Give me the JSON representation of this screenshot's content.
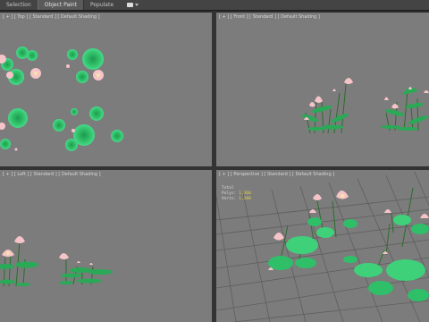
{
  "toolbar": {
    "tabs": [
      {
        "label": "Selection",
        "active": false
      },
      {
        "label": "Object Paint",
        "active": true
      },
      {
        "label": "Populate",
        "active": false
      }
    ],
    "dropdown_icon": "square-dropdown-icon"
  },
  "viewports": {
    "top": {
      "label": "[ + ] [ Top ] [ Standard ] [ Default Shading ]"
    },
    "front": {
      "label": "[ + ] [ Front ] [ Standard ] [ Default Shading ]"
    },
    "left": {
      "label": "[ + ] [ Left ] [ Standard ] [ Default Shading ]"
    },
    "perspective": {
      "label": "[ + ] [ Perspective ] [ Standard ] [ Default Shading ]",
      "stats": [
        {
          "key": "Total",
          "value": ""
        },
        {
          "key": "Polys:",
          "value": "1,360"
        },
        {
          "key": "Verts:",
          "value": "1,380"
        }
      ]
    }
  },
  "colors": {
    "viewport_bg": "#7c7c7c",
    "leaf_light": "#3fd17a",
    "leaf_dark": "#1f9a4e",
    "petal": "#f6c4c8",
    "petal_center": "#f4e7a4",
    "stem": "#2a6e2e",
    "grid": "#5e5e5e",
    "stats_value": "#e8d24a"
  }
}
